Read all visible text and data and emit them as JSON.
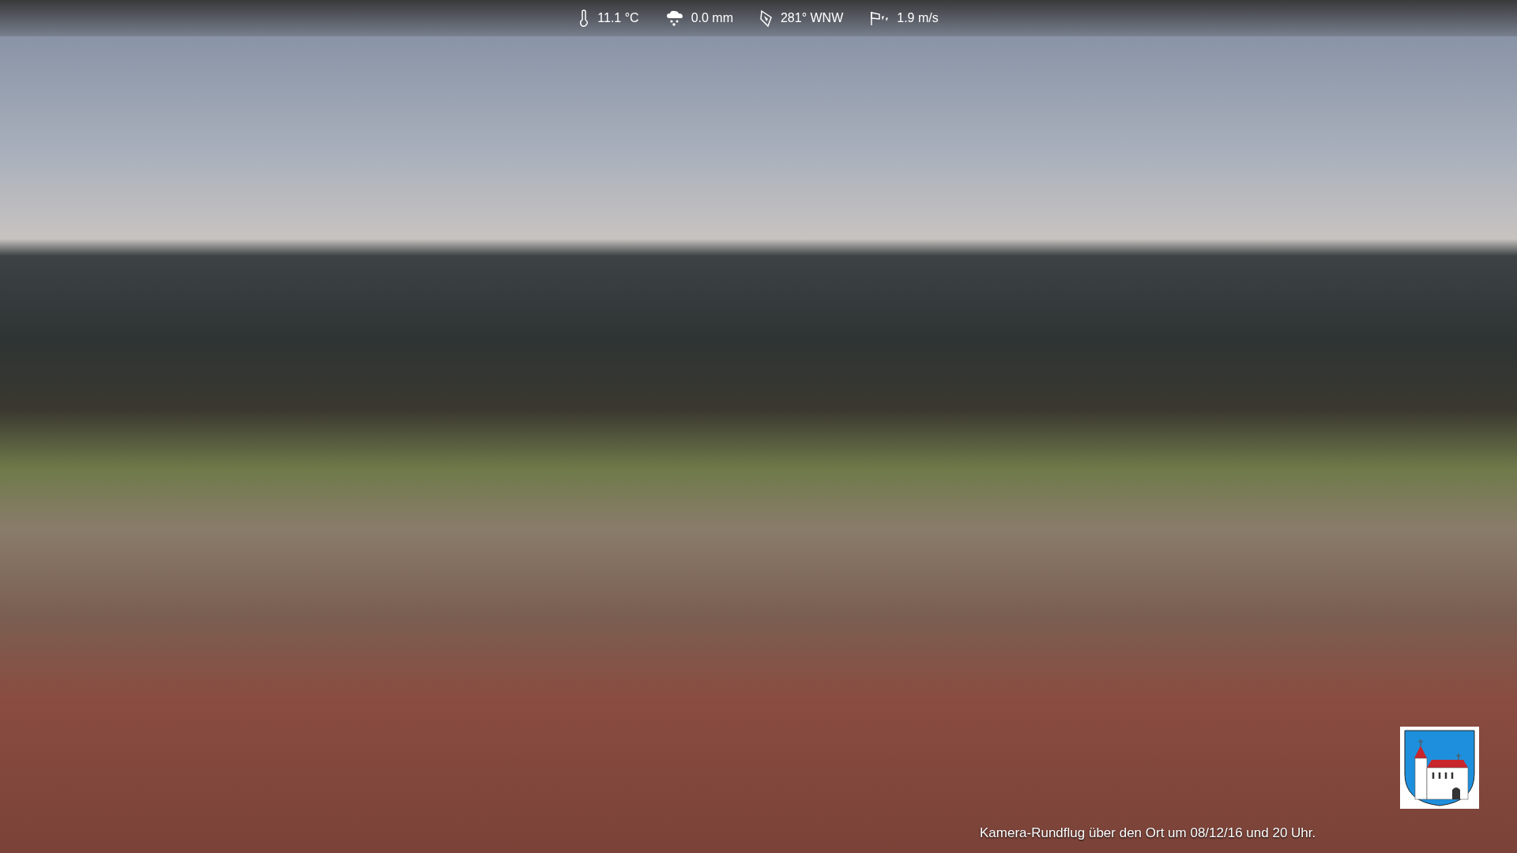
{
  "weather": [
    {
      "kind": "temperature",
      "value": "11.1 °C"
    },
    {
      "kind": "rain",
      "value": "0.0 mm"
    },
    {
      "kind": "wind_direction",
      "value": "281° WNW"
    },
    {
      "kind": "wind_speed",
      "value": "1.9 m/s"
    }
  ],
  "caption": "Kamera-Rundflug über den Ort um 08/12/16 und 20 Uhr."
}
